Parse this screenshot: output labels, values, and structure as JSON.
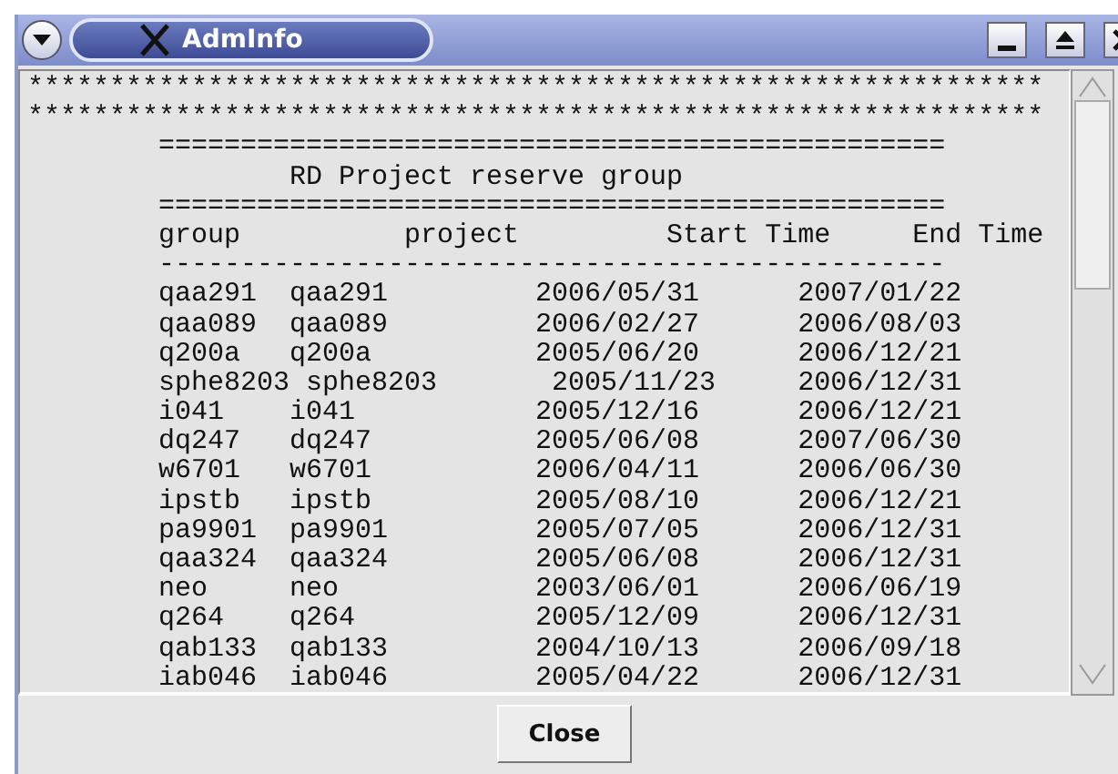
{
  "window": {
    "title": "AdmInfo"
  },
  "text_lines": [
    "**************************************************************",
    "**************************************************************",
    "        ================================================",
    "                RD Project reserve group",
    "        ================================================",
    "        group          project         Start Time     End Time",
    "        ------------------------------------------------",
    "        qaa291  qaa291         2006/05/31      2007/01/22",
    "        qaa089  qaa089         2006/02/27      2006/08/03",
    "        q200a   q200a          2005/06/20      2006/12/21",
    "        sphe8203 sphe8203       2005/11/23     2006/12/31",
    "        i041    i041           2005/12/16      2006/12/21",
    "        dq247   dq247          2005/06/08      2007/06/30",
    "        w6701   w6701          2006/04/11      2006/06/30",
    "        ipstb   ipstb          2005/08/10      2006/12/21",
    "        pa9901  pa9901         2005/07/05      2006/12/31",
    "        qaa324  qaa324         2005/06/08      2006/12/31",
    "        neo     neo            2003/06/01      2006/06/19",
    "        q264    q264           2005/12/09      2006/12/31",
    "        qab133  qab133         2004/10/13      2006/09/18",
    "        iab046  iab046         2005/04/22      2006/12/31"
  ],
  "buttons": [
    {
      "label": "Close"
    }
  ]
}
